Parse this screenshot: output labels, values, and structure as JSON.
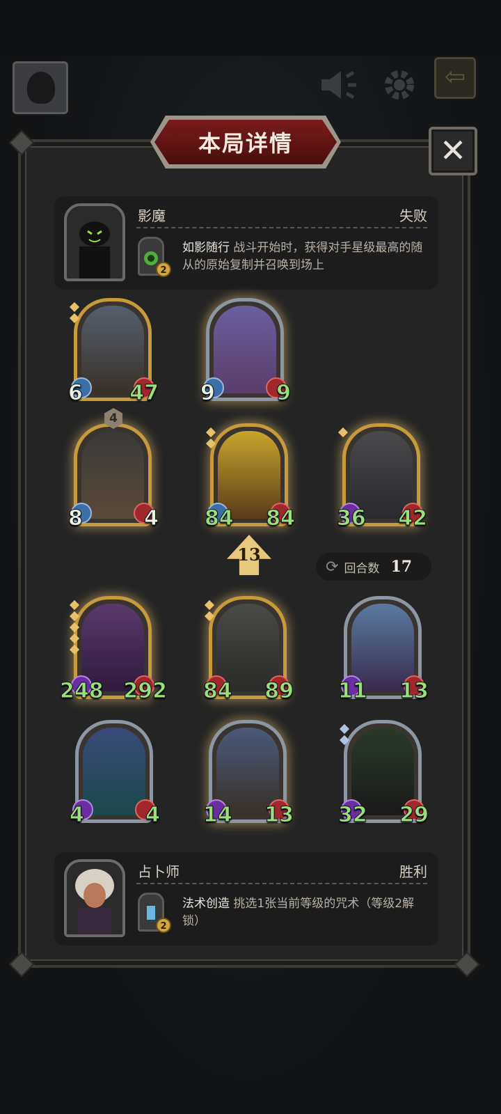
{
  "header": {
    "title": "本局详情",
    "close": "✕"
  },
  "opponent": {
    "name": "影魔",
    "result": "失败",
    "skill": {
      "name": "如影随行",
      "desc": "战斗开始时，获得对手星级最高的随从的原始复制并召唤到场上",
      "level": "2"
    }
  },
  "player": {
    "name": "占卜师",
    "result": "胜利",
    "skill": {
      "name": "法术创造",
      "desc": "挑选1张当前等级的咒术（等级2解锁）",
      "level": "2"
    }
  },
  "opponent_board": [
    {
      "atk": "6",
      "hp": "47"
    },
    {
      "atk": "9",
      "hp": "9"
    },
    {
      "atk": "8",
      "hp": "4",
      "level": "4"
    },
    {
      "atk": "84",
      "hp": "84"
    },
    {
      "atk": "36",
      "hp": "42"
    }
  ],
  "player_board": [
    {
      "atk": "248",
      "hp": "292"
    },
    {
      "atk": "84",
      "hp": "89"
    },
    {
      "atk": "11",
      "hp": "13"
    },
    {
      "atk": "4",
      "hp": "4"
    },
    {
      "atk": "14",
      "hp": "13"
    },
    {
      "atk": "32",
      "hp": "29"
    }
  ],
  "turn": {
    "arrow_value": "13",
    "rounds_label": "回合数",
    "rounds_value": "17"
  },
  "colors": {
    "gold_frame": "#c79a3b",
    "silver_frame": "#8d96a3",
    "title_red": "#7a1b1b",
    "stat_green": "#9ae07a"
  },
  "icons": {
    "sound": "speaker-muted-icon",
    "settings": "gear-icon",
    "exit": "exit-icon",
    "rounds": "cycle-icon"
  }
}
